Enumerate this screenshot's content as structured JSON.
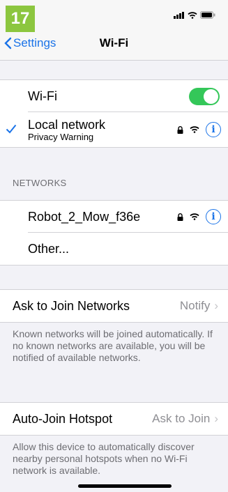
{
  "step": "17",
  "nav": {
    "back_label": "Settings",
    "title": "Wi-Fi"
  },
  "wifi": {
    "label": "Wi-Fi",
    "enabled": true
  },
  "connected": {
    "name": "Local network",
    "sub": "Privacy Warning"
  },
  "networks_header": "NETWORKS",
  "networks": [
    {
      "name": "Robot_2_Mow_f36e"
    },
    {
      "name": "Other..."
    }
  ],
  "ask_join": {
    "label": "Ask to Join Networks",
    "value": "Notify",
    "footer": "Known networks will be joined automatically. If no known networks are available, you will be notified of available networks."
  },
  "auto_join": {
    "label": "Auto-Join Hotspot",
    "value": "Ask to Join",
    "footer": "Allow this device to automatically discover nearby personal hotspots when no Wi-Fi network is available."
  },
  "colors": {
    "accent": "#1a73e8",
    "toggle_on": "#34c759",
    "badge": "#8cc63f"
  }
}
